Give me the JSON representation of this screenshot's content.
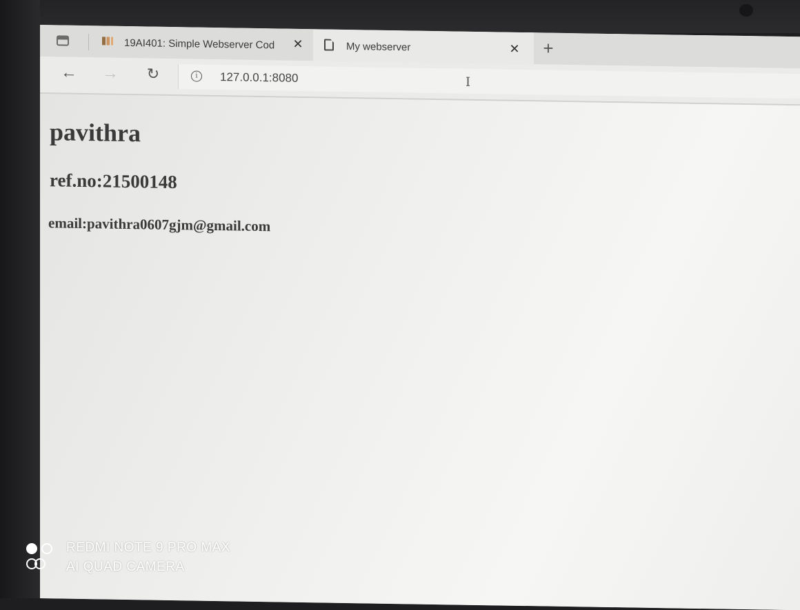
{
  "browser": {
    "tabs": [
      {
        "title": "19AI401: Simple Webserver Cod",
        "close_glyph": "✕",
        "active": false
      },
      {
        "title": "My webserver",
        "close_glyph": "✕",
        "active": true
      }
    ],
    "new_tab_glyph": "+",
    "nav": {
      "back_glyph": "←",
      "forward_glyph": "→",
      "refresh_glyph": "↻"
    },
    "address": {
      "info_glyph": "i",
      "url": "127.0.0.1:8080"
    },
    "cursor_glyph": "I"
  },
  "page": {
    "heading": "pavithra",
    "ref": "ref.no:21500148",
    "email": "email:pavithra0607gjm@gmail.com"
  },
  "watermark": {
    "line1": "REDMI NOTE 9 PRO MAX",
    "line2": "AI QUAD CAMERA"
  },
  "colors": {
    "tabbar": "#dcdcda",
    "active_tab": "#e9e9e7",
    "page_background": "#ececea",
    "text": "#3a3a3a"
  }
}
